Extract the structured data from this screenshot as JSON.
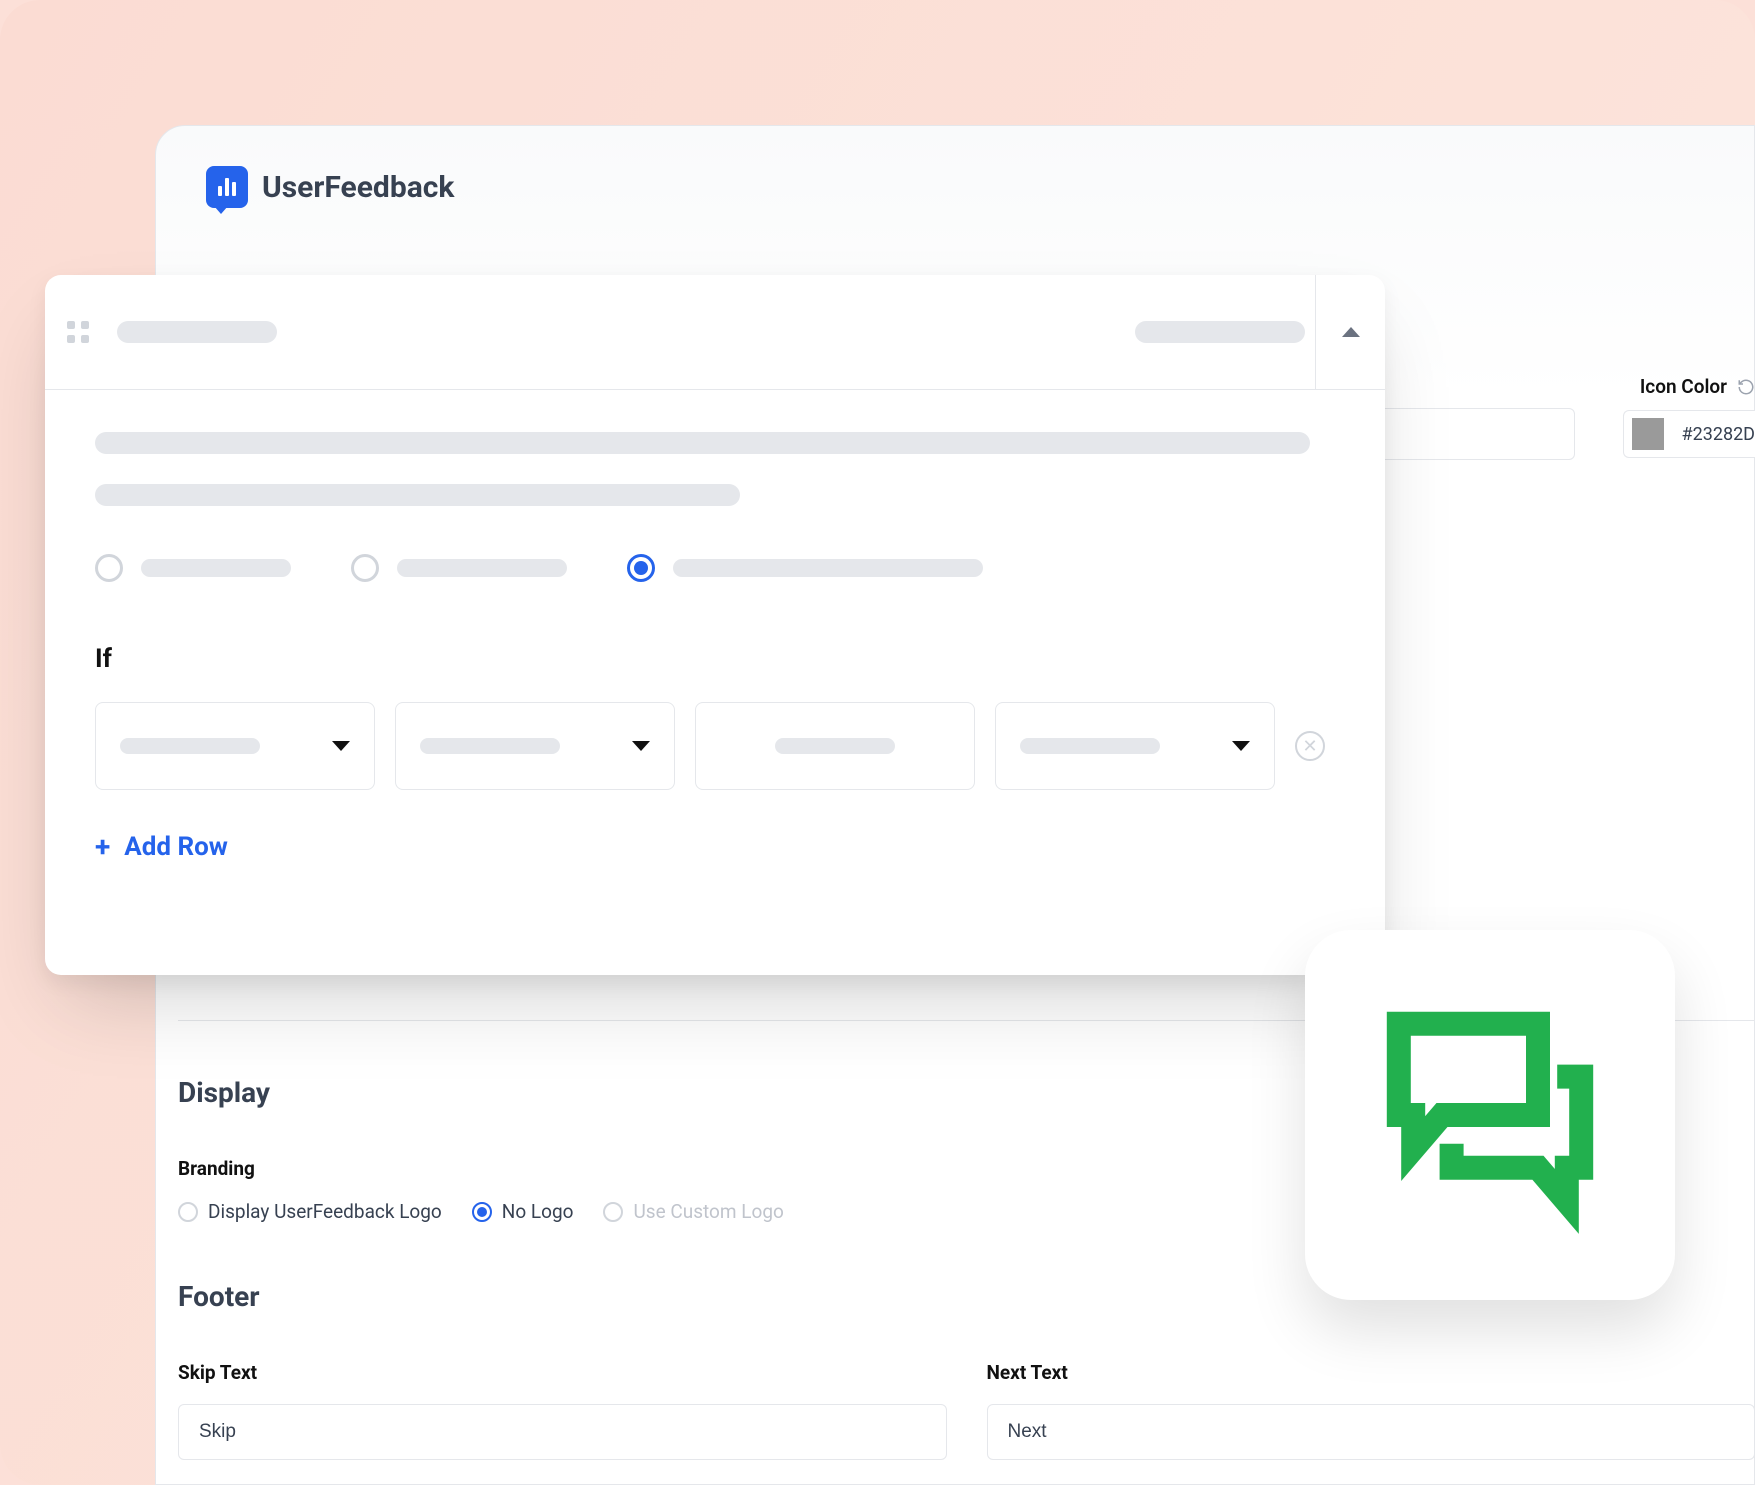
{
  "app": {
    "name": "UserFeedback"
  },
  "iconColor": {
    "label": "Icon Color",
    "value": "#23282D"
  },
  "logic": {
    "if_label": "If",
    "add_row_label": "Add Row"
  },
  "display": {
    "section_title": "Display",
    "branding_label": "Branding",
    "options": {
      "show_logo": "Display UserFeedback Logo",
      "no_logo": "No Logo",
      "custom_logo": "Use Custom Logo"
    }
  },
  "footer": {
    "section_title": "Footer",
    "skip": {
      "label": "Skip Text",
      "value": "Skip"
    },
    "next": {
      "label": "Next Text",
      "value": "Next"
    }
  },
  "colors": {
    "accent": "#2563eb",
    "chat_green": "#22b04e"
  }
}
